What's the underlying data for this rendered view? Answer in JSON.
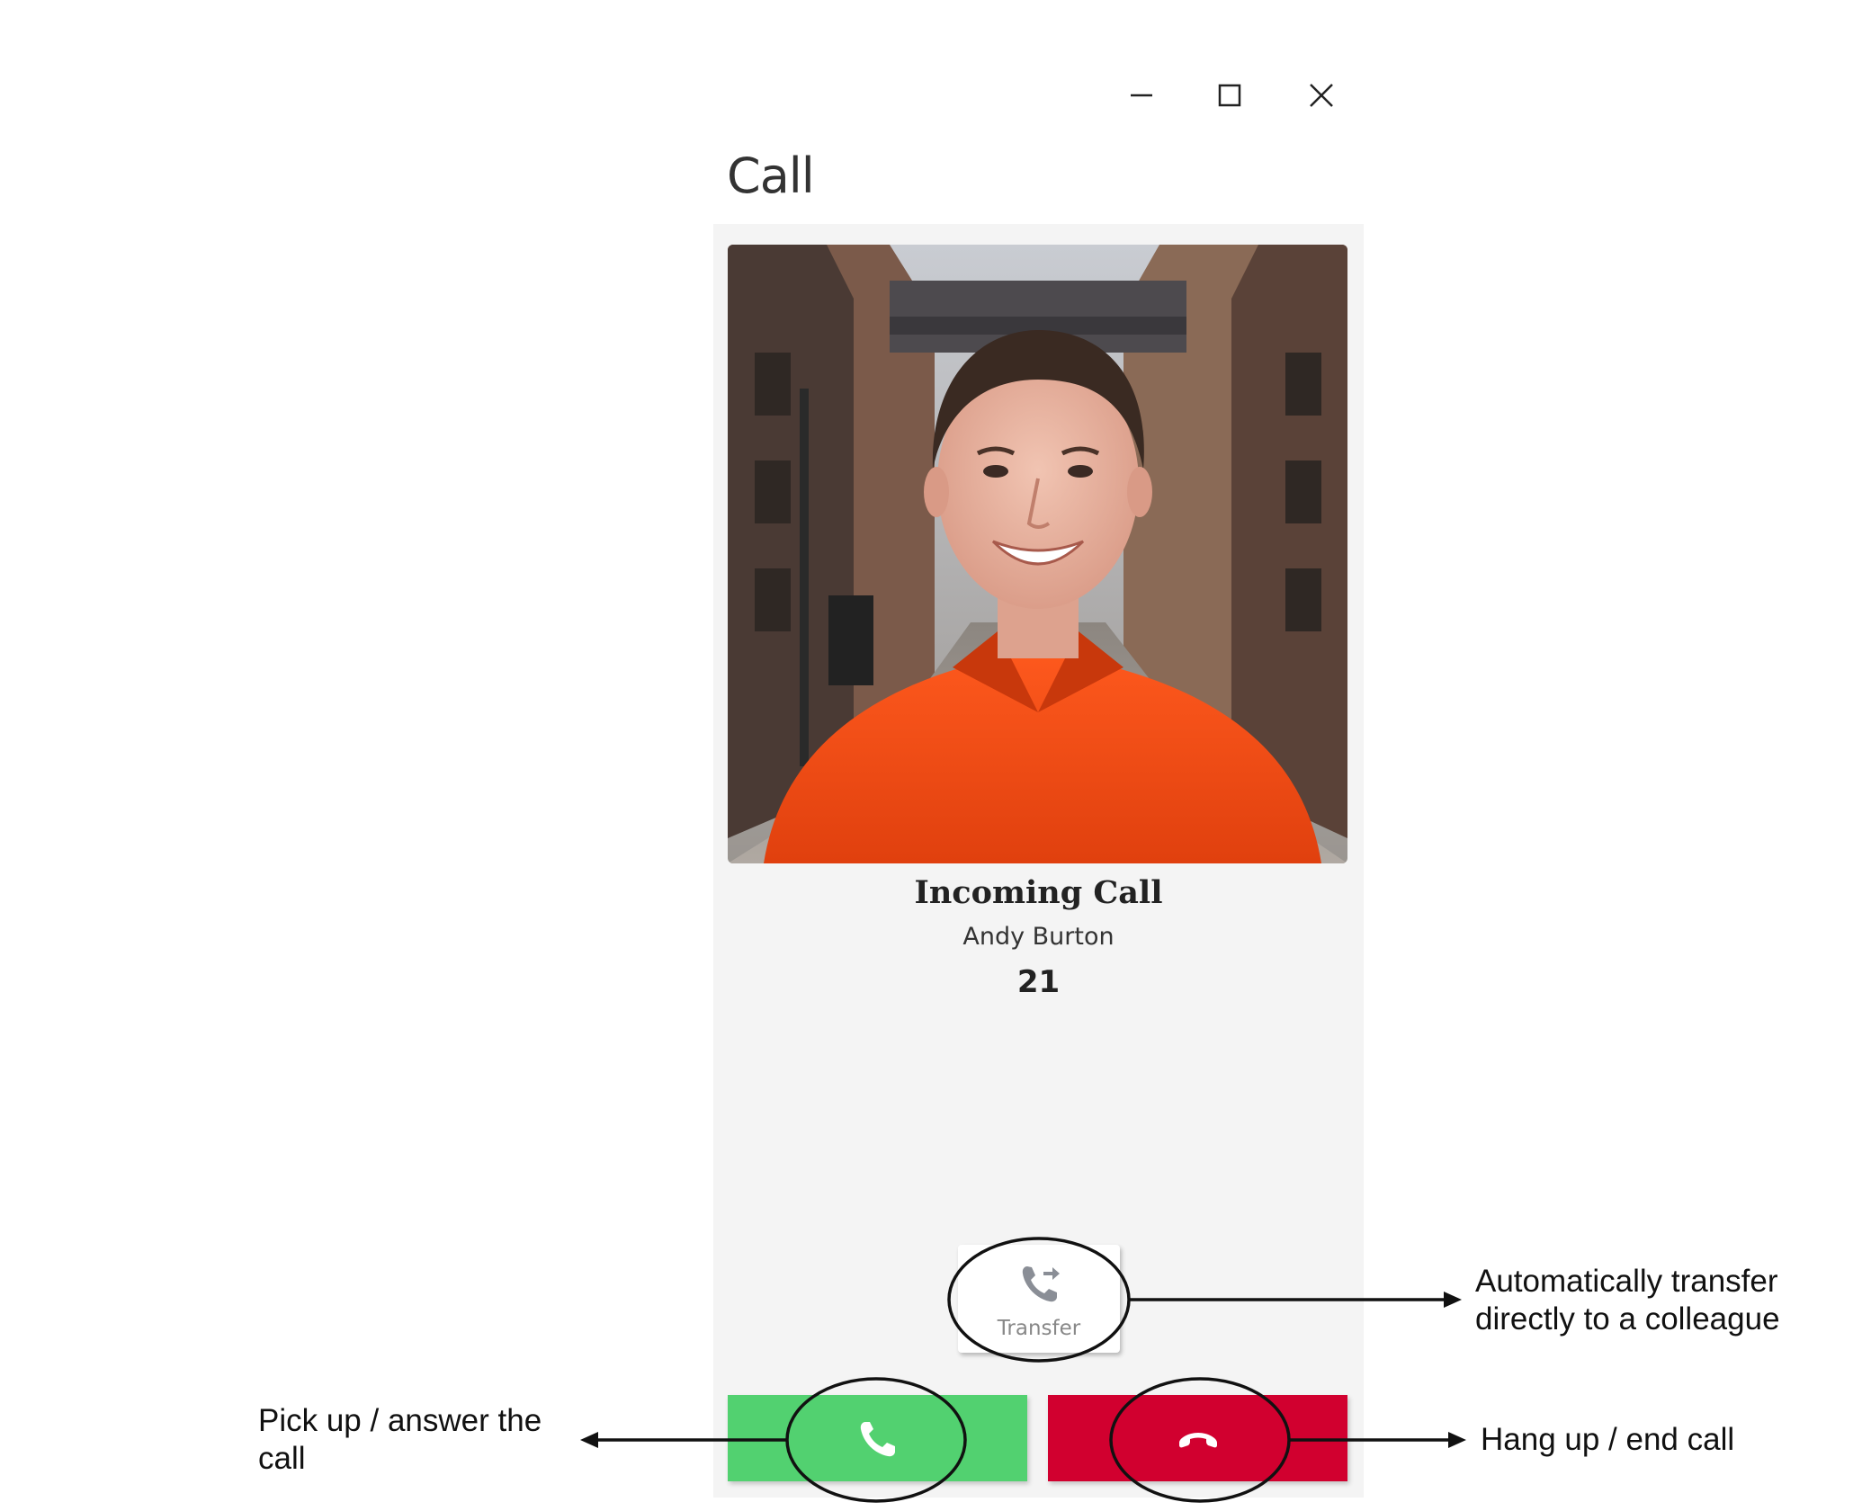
{
  "window": {
    "title": "Call",
    "controls": {
      "minimize": "minimize-icon",
      "maximize": "maximize-icon",
      "close": "close-icon"
    }
  },
  "call": {
    "status": "Incoming Call",
    "caller_name": "Andy Burton",
    "extension": "21",
    "photo": "caller-photo"
  },
  "actions": {
    "transfer_label": "Transfer",
    "transfer_icon": "phone-forward-icon",
    "answer_icon": "phone-icon",
    "hangup_icon": "phone-hangup-icon",
    "answer_color": "#52d170",
    "hangup_color": "#d1002f"
  },
  "annotations": {
    "answer_line1": "Pick up / answer the",
    "answer_line2": "call",
    "transfer_line1": "Automatically transfer",
    "transfer_line2": "directly to a colleague",
    "hangup": "Hang up / end call"
  }
}
